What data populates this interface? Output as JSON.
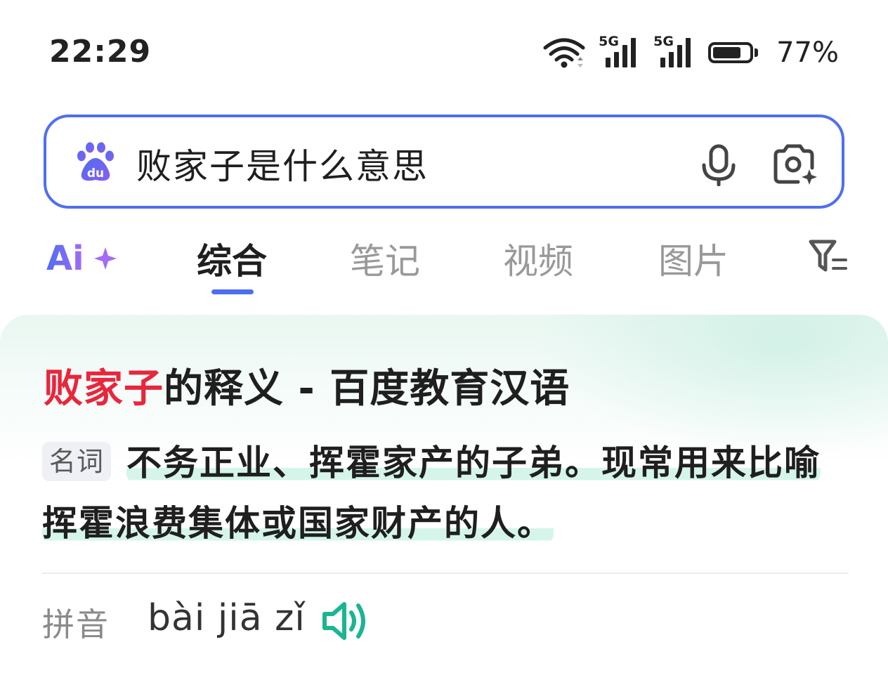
{
  "status_bar": {
    "time": "22:29",
    "network_1": "5G",
    "network_2": "5G",
    "battery_pct": "77%",
    "battery_level": 0.77
  },
  "search": {
    "query": "败家子是什么意思",
    "logo_text": "du"
  },
  "tabs": {
    "ai_label": "Ai",
    "items": [
      "综合",
      "笔记",
      "视频",
      "图片"
    ],
    "active_index": 0
  },
  "result_card": {
    "title_highlight": "败家子",
    "title_rest": "的释义 - 百度教育汉语",
    "pos_tag": "名词",
    "definition": "不务正业、挥霍家产的子弟。现常用来比喻挥霍浪费集体或国家财产的人。",
    "pinyin_label": "拼音",
    "pinyin": "bài jiā zǐ"
  },
  "colors": {
    "accent": "#4e6ef2",
    "highlight_red": "#e8263c",
    "def_highlight": "#d6f5ea",
    "speaker": "#1bb592",
    "ai_gradient_start": "#4e6ef2",
    "ai_gradient_end": "#a46bf5"
  }
}
